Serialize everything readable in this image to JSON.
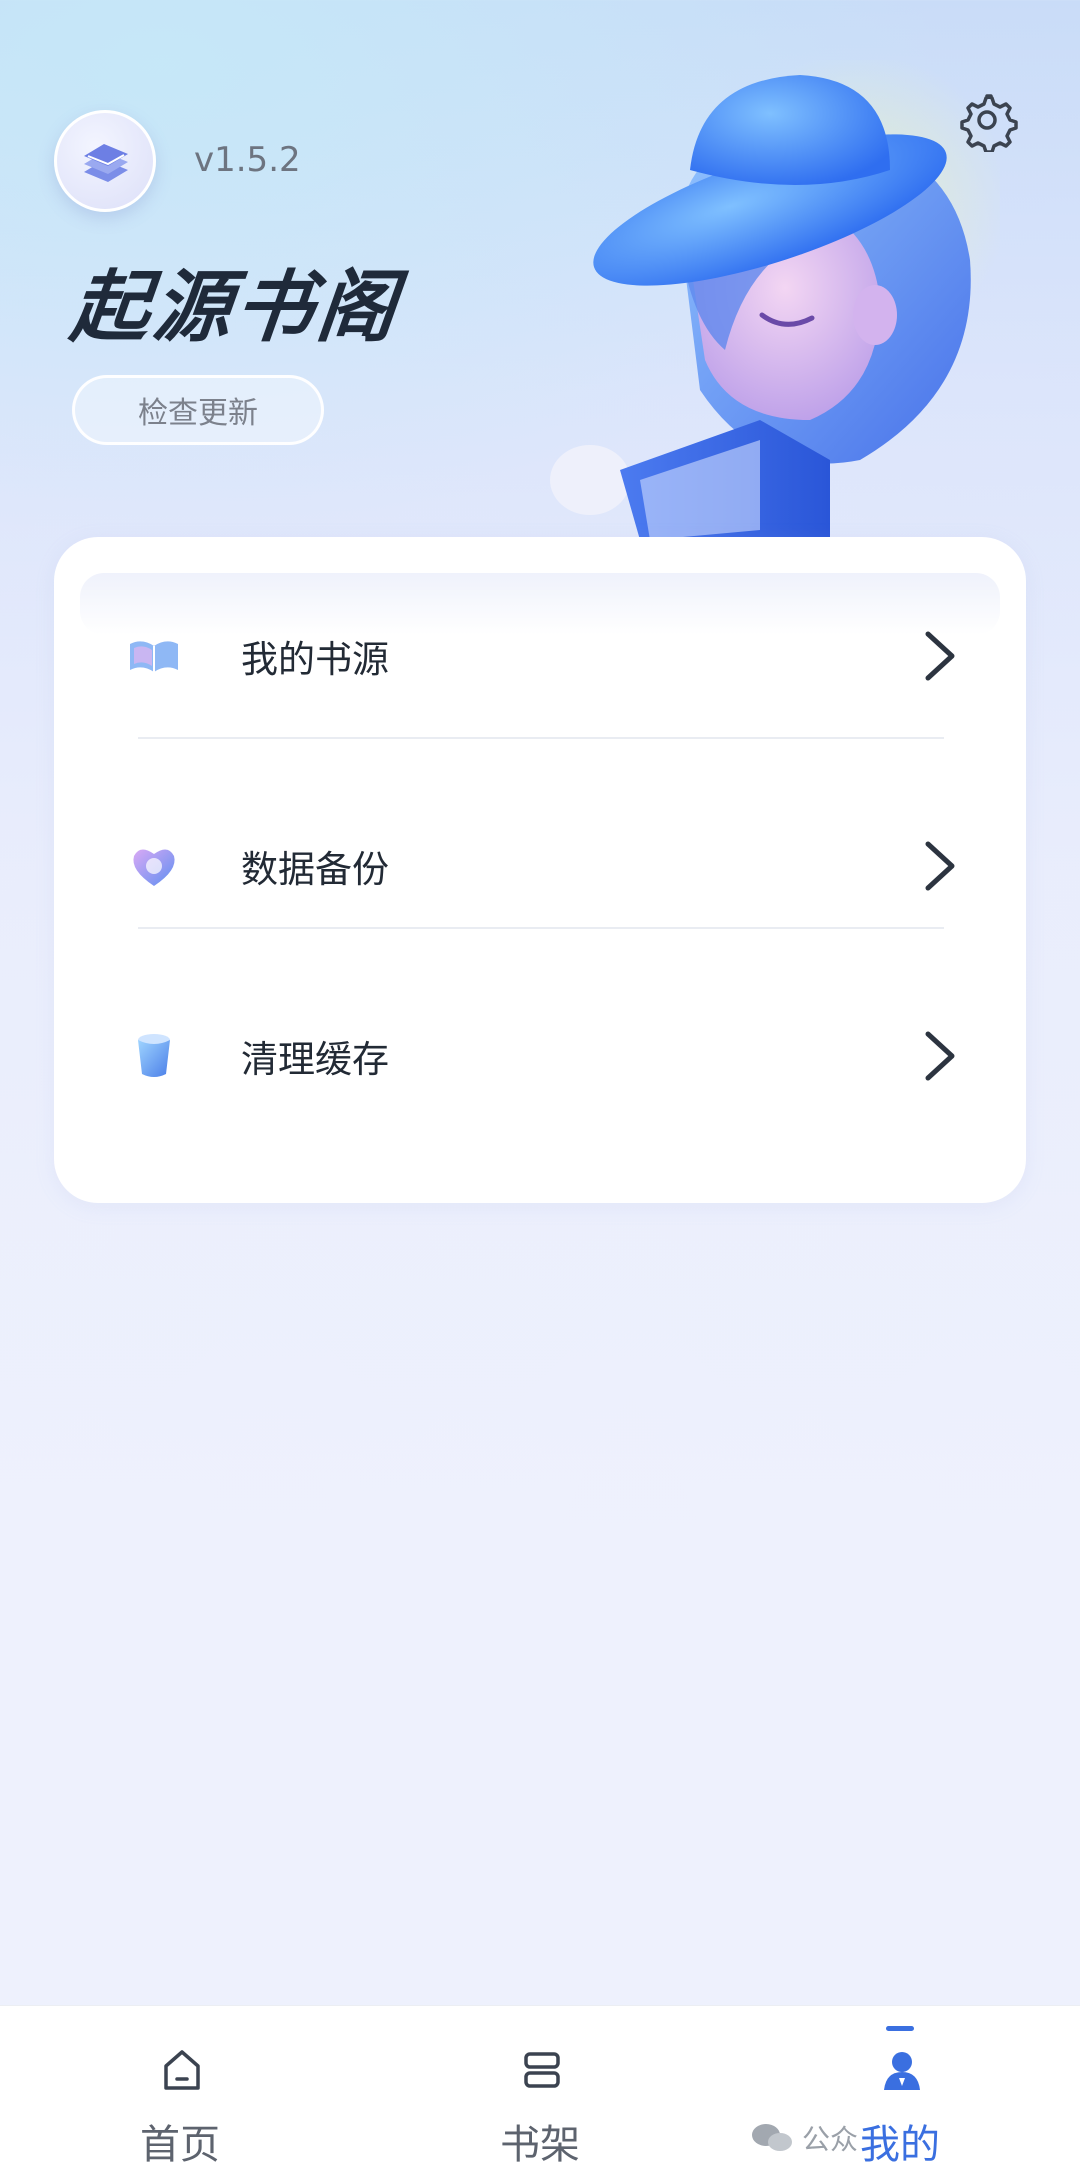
{
  "header": {
    "version": "v1.5.2",
    "app_title": "起源书阁",
    "update_button": "检查更新"
  },
  "menu": {
    "items": [
      {
        "label": "我的书源",
        "icon": "book-source-icon"
      },
      {
        "label": "数据备份",
        "icon": "heart-backup-icon"
      },
      {
        "label": "清理缓存",
        "icon": "trash-bin-icon"
      }
    ]
  },
  "nav": {
    "items": [
      {
        "label": "首页",
        "icon": "home-icon"
      },
      {
        "label": "书架",
        "icon": "bookshelf-icon"
      },
      {
        "label": "我的",
        "icon": "user-icon",
        "active": true
      }
    ]
  },
  "watermark": {
    "text": "公众"
  },
  "colors": {
    "accent": "#3a6fe0",
    "text": "#222a35",
    "muted": "#7c818c"
  }
}
